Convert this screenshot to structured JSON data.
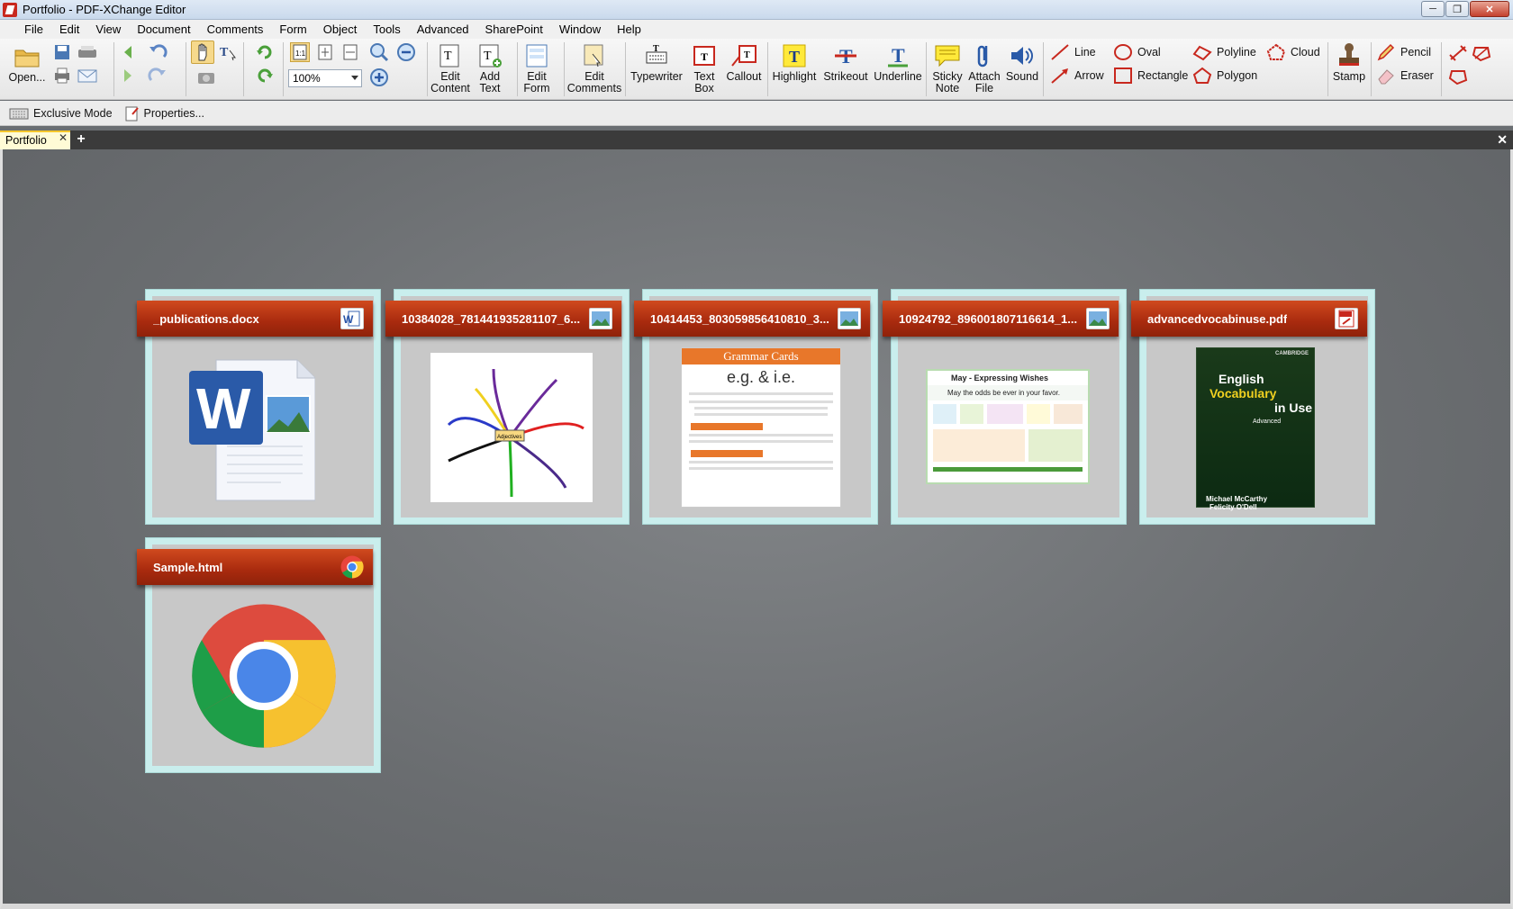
{
  "window": {
    "title": "Portfolio - PDF-XChange Editor"
  },
  "menu": [
    "File",
    "Edit",
    "View",
    "Document",
    "Comments",
    "Form",
    "Object",
    "Tools",
    "Advanced",
    "SharePoint",
    "Window",
    "Help"
  ],
  "ribbon": {
    "open_label": "Open...",
    "zoom_value": "100%",
    "edit_content": [
      "Edit",
      "Content"
    ],
    "add_text": [
      "Add",
      "Text"
    ],
    "edit_form": [
      "Edit",
      "Form"
    ],
    "edit_comments": [
      "Edit",
      "Comments"
    ],
    "typewriter": "Typewriter",
    "text_box": [
      "Text",
      "Box"
    ],
    "callout": "Callout",
    "highlight": "Highlight",
    "strikeout": "Strikeout",
    "underline": "Underline",
    "sticky_note": [
      "Sticky",
      "Note"
    ],
    "attach_file": [
      "Attach",
      "File"
    ],
    "sound": "Sound",
    "line": "Line",
    "arrow": "Arrow",
    "oval": "Oval",
    "rectangle": "Rectangle",
    "polyline": "Polyline",
    "polygon": "Polygon",
    "cloud": "Cloud",
    "stamp": "Stamp",
    "pencil": "Pencil",
    "eraser": "Eraser"
  },
  "toolbar2": {
    "exclusive_mode": "Exclusive Mode",
    "properties": "Properties..."
  },
  "tabs": {
    "active": "Portfolio"
  },
  "files": [
    {
      "name": "_publications.docx",
      "type": "word"
    },
    {
      "name": "10384028_781441935281107_6...",
      "type": "image"
    },
    {
      "name": "10414453_803059856410810_3...",
      "type": "image"
    },
    {
      "name": "10924792_896001807116614_1...",
      "type": "image"
    },
    {
      "name": "advancedvocabinuse.pdf",
      "type": "pdf"
    },
    {
      "name": "Sample.html",
      "type": "html"
    }
  ],
  "thumbs": {
    "grammar_header": "Grammar Cards",
    "grammar_title": "e.g. & i.e.",
    "may_title": "May - Expressing Wishes",
    "may_line": "May the odds be ever in your favor.",
    "book_publisher": "CAMBRIDGE",
    "book_title_1": "English",
    "book_title_2": "Vocabulary",
    "book_title_3": "in Use",
    "book_level": "Advanced",
    "book_authors_1": "Michael McCarthy",
    "book_authors_2": "Felicity O'Dell",
    "mindmap_center": "Adjectives"
  },
  "colors": {
    "card_header": "#b4320f",
    "card_bg": "#c9eeed",
    "tab_accent": "#f5c72c"
  }
}
